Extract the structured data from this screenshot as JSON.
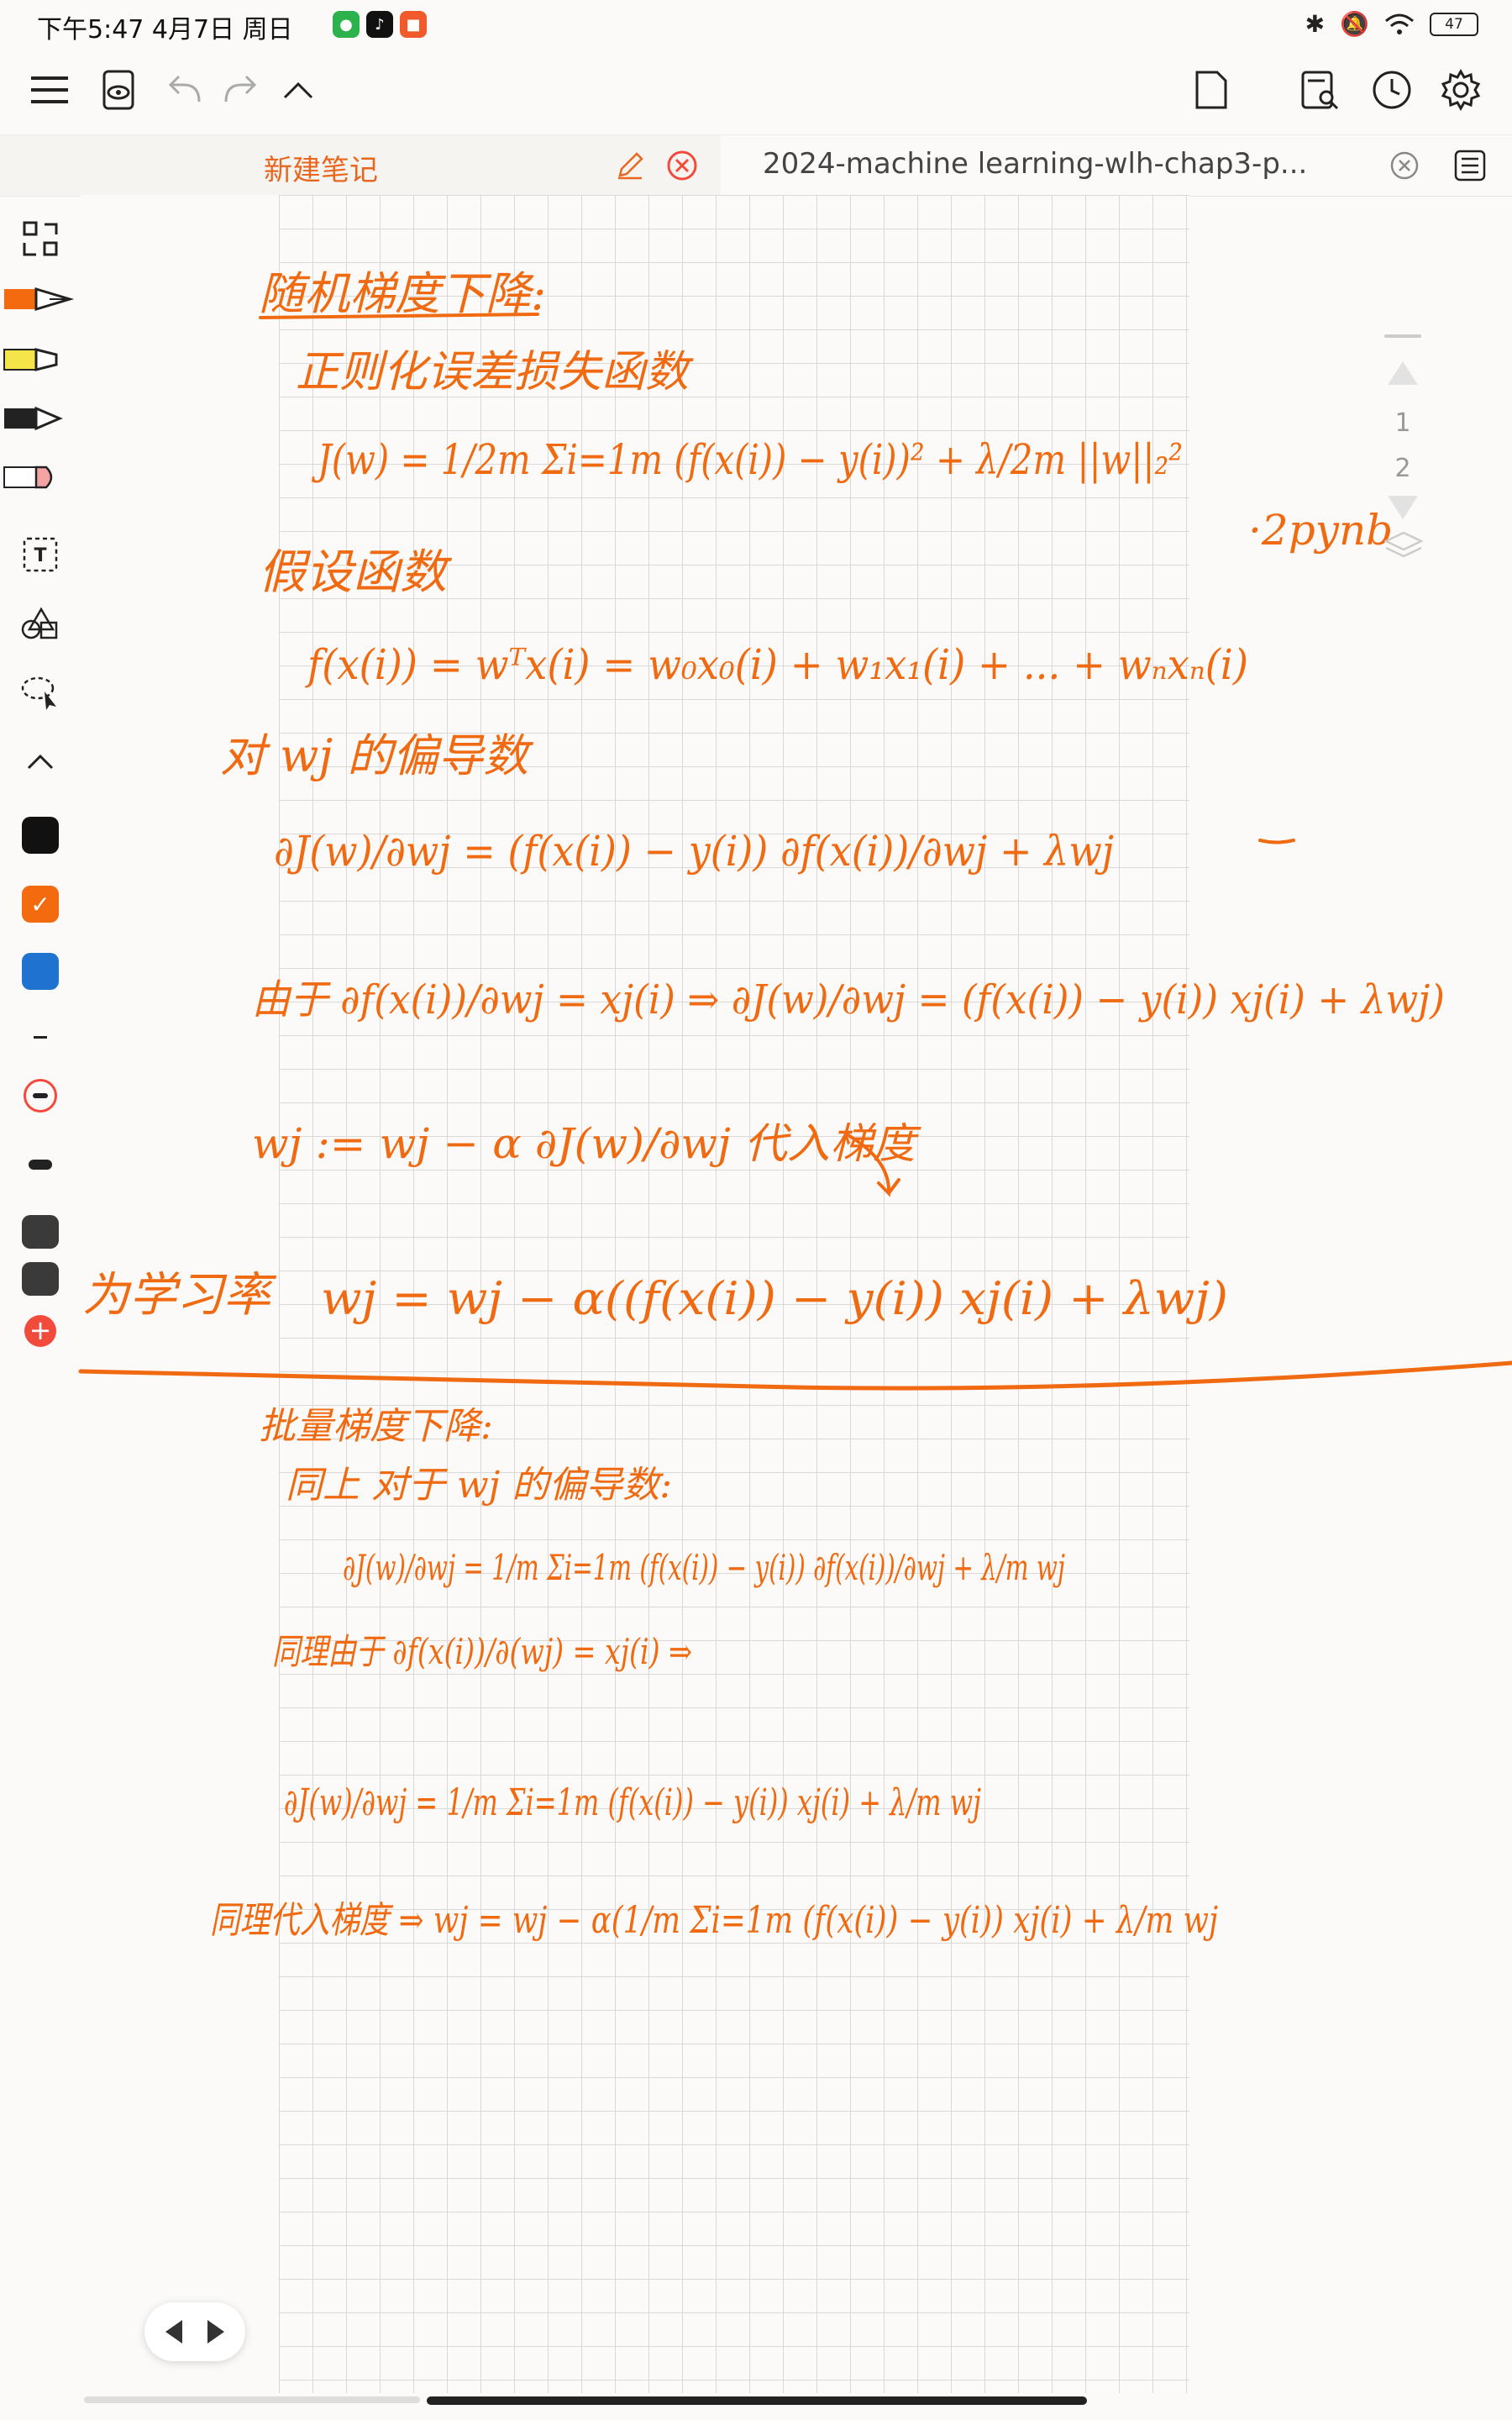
{
  "status": {
    "time_text": "下午5:47 4月7日 周日",
    "battery": "47"
  },
  "tabs": [
    {
      "title": "新建笔记"
    },
    {
      "title": "2024-machine learning-wlh-chap3-p..."
    }
  ],
  "page_nav": {
    "page1": "1",
    "page2": "2"
  },
  "colors": {
    "accent": "#e8661e",
    "black": "#111111",
    "blue": "#1f72d0",
    "red": "#f24b3c"
  },
  "notes": {
    "heading1": "随机梯度下降:",
    "line_reg": "正则化误差损失函数",
    "line_J": "J(w) = 1/2m Σi=1m (f(x(i)) − y(i))² + λ/2m ||w||₂²",
    "note_right": "·2pynb",
    "line_hyp_title": "假设函数",
    "line_hyp": "f(x(i)) = wᵀx(i) = w₀x₀(i) + w₁x₁(i) + ... + wₙxₙ(i)",
    "line_partial_title": "对 wj 的偏导数",
    "line_partial": "∂J(w)/∂wj = (f(x(i)) − y(i)) ∂f(x(i))/∂wj + λwj",
    "line_since": "由于 ∂f(x(i))/∂wj = xj(i) ⇒ ∂J(w)/∂wj = (f(x(i)) − y(i)) xj(i) + λwj)",
    "line_update": "wj := wj − α ∂J(w)/∂wj  代入梯度",
    "margin_label": "为学习率",
    "line_final": "wj = wj − α((f(x(i)) − y(i)) xj(i) + λwj)",
    "heading2": "批量梯度下降:",
    "line_same": "同上 对于 wj 的偏导数:",
    "line_batch_partial": "∂J(w)/∂wj = 1/m Σi=1m (f(x(i)) − y(i)) ∂f(x(i))/∂wj + λ/m wj",
    "line_batch_since": "同理由于 ∂f(x(i))/∂(wj) = xj(i) ⇒",
    "line_batch_grad": "∂J(w)/∂wj = 1/m Σi=1m (f(x(i)) − y(i)) xj(i) + λ/m wj",
    "line_batch_update": "同理代入梯度 ⇒ wj = wj − α(1/m Σi=1m (f(x(i)) − y(i)) xj(i) + λ/m wj"
  }
}
